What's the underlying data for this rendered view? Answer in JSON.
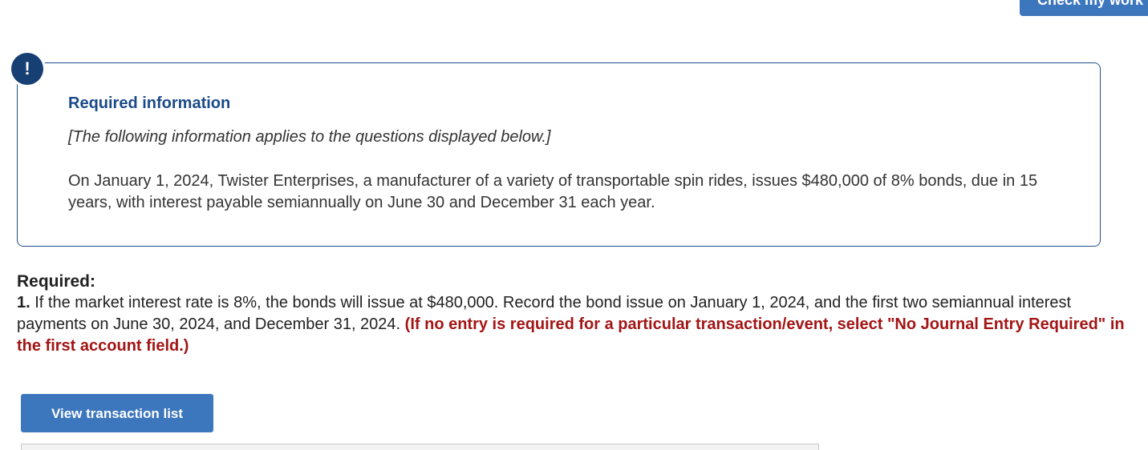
{
  "header": {
    "check_button_label": "Check my work"
  },
  "alert": {
    "icon_glyph": "!",
    "title": "Required information",
    "note": "[The following information applies to the questions displayed below.]",
    "body": "On January 1, 2024, Twister Enterprises, a manufacturer of a variety of transportable spin rides, issues $480,000 of 8% bonds, due in 15 years, with interest payable semiannually on June 30 and December 31 each year."
  },
  "required": {
    "heading": "Required:",
    "item_number": "1.",
    "item_text": " If the market interest rate is 8%, the bonds will issue at $480,000. Record the bond issue on January 1, 2024, and the first two semiannual interest payments on June 30, 2024, and December 31, 2024. ",
    "item_instruction": "(If no entry is required for a particular transaction/event, select \"No Journal Entry Required\" in the first account field.)"
  },
  "actions": {
    "view_transactions_label": "View transaction list"
  },
  "colors": {
    "primary_button": "#3c76bd",
    "alert_border": "#1f4e8c",
    "alert_title": "#1a4a8a",
    "instruction_red": "#a31515"
  }
}
